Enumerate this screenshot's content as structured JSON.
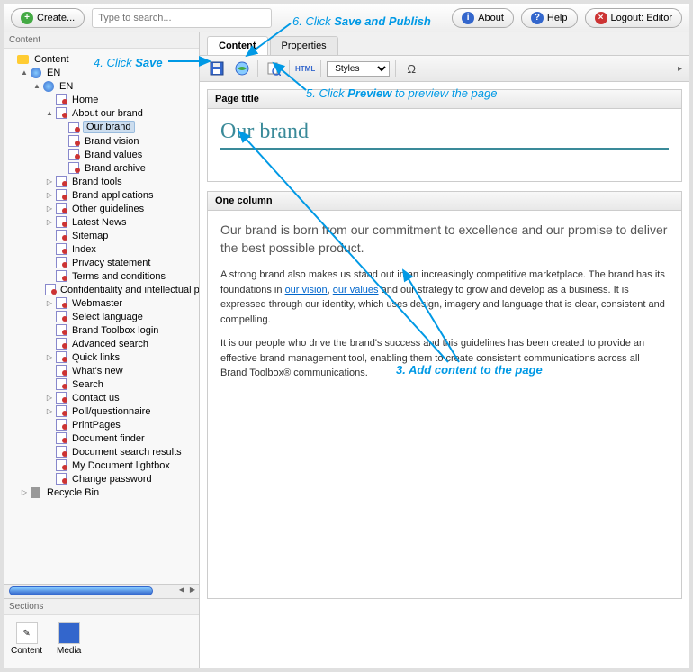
{
  "top": {
    "create": "Create...",
    "search_placeholder": "Type to search...",
    "about": "About",
    "help": "Help",
    "logout": "Logout: Editor"
  },
  "sidebar": {
    "content_hd": "Content",
    "sections_hd": "Sections",
    "sec_content": "Content",
    "sec_media": "Media"
  },
  "tree": [
    {
      "ind": 0,
      "tgl": "",
      "icon": "folder",
      "label": "Content"
    },
    {
      "ind": 1,
      "tgl": "▲",
      "icon": "globe",
      "label": "EN"
    },
    {
      "ind": 2,
      "tgl": "▲",
      "icon": "globe",
      "label": "EN"
    },
    {
      "ind": 3,
      "tgl": "",
      "icon": "page",
      "label": "Home"
    },
    {
      "ind": 3,
      "tgl": "▲",
      "icon": "page",
      "label": "About our brand"
    },
    {
      "ind": 4,
      "tgl": "",
      "icon": "page",
      "label": "Our brand",
      "selected": true
    },
    {
      "ind": 4,
      "tgl": "",
      "icon": "page",
      "label": "Brand vision"
    },
    {
      "ind": 4,
      "tgl": "",
      "icon": "page",
      "label": "Brand values"
    },
    {
      "ind": 4,
      "tgl": "",
      "icon": "page",
      "label": "Brand archive"
    },
    {
      "ind": 3,
      "tgl": "▷",
      "icon": "page",
      "label": "Brand tools"
    },
    {
      "ind": 3,
      "tgl": "▷",
      "icon": "page",
      "label": "Brand applications"
    },
    {
      "ind": 3,
      "tgl": "▷",
      "icon": "page",
      "label": "Other guidelines"
    },
    {
      "ind": 3,
      "tgl": "▷",
      "icon": "page",
      "label": "Latest News"
    },
    {
      "ind": 3,
      "tgl": "",
      "icon": "page",
      "label": "Sitemap"
    },
    {
      "ind": 3,
      "tgl": "",
      "icon": "page",
      "label": "Index"
    },
    {
      "ind": 3,
      "tgl": "",
      "icon": "page",
      "label": "Privacy statement"
    },
    {
      "ind": 3,
      "tgl": "",
      "icon": "page",
      "label": "Terms and conditions"
    },
    {
      "ind": 3,
      "tgl": "",
      "icon": "page",
      "label": "Confidentiality and intellectual p"
    },
    {
      "ind": 3,
      "tgl": "▷",
      "icon": "page",
      "label": "Webmaster"
    },
    {
      "ind": 3,
      "tgl": "",
      "icon": "page",
      "label": "Select language"
    },
    {
      "ind": 3,
      "tgl": "",
      "icon": "page",
      "label": "Brand Toolbox login"
    },
    {
      "ind": 3,
      "tgl": "",
      "icon": "page",
      "label": "Advanced search"
    },
    {
      "ind": 3,
      "tgl": "▷",
      "icon": "page",
      "label": "Quick links"
    },
    {
      "ind": 3,
      "tgl": "",
      "icon": "page",
      "label": "What's new"
    },
    {
      "ind": 3,
      "tgl": "",
      "icon": "page",
      "label": "Search"
    },
    {
      "ind": 3,
      "tgl": "▷",
      "icon": "page",
      "label": "Contact us"
    },
    {
      "ind": 3,
      "tgl": "▷",
      "icon": "page",
      "label": "Poll/questionnaire"
    },
    {
      "ind": 3,
      "tgl": "",
      "icon": "page",
      "label": "PrintPages"
    },
    {
      "ind": 3,
      "tgl": "",
      "icon": "page",
      "label": "Document finder"
    },
    {
      "ind": 3,
      "tgl": "",
      "icon": "page",
      "label": "Document search results"
    },
    {
      "ind": 3,
      "tgl": "",
      "icon": "page",
      "label": "My Document lightbox"
    },
    {
      "ind": 3,
      "tgl": "",
      "icon": "page",
      "label": "Change password"
    },
    {
      "ind": 1,
      "tgl": "▷",
      "icon": "recycle",
      "label": "Recycle Bin"
    }
  ],
  "editor": {
    "tab_content": "Content",
    "tab_properties": "Properties",
    "styles_label": "Styles",
    "html_label": "HTML",
    "omega": "Ω",
    "block1_hd": "Page title",
    "page_title": "Our brand",
    "block2_hd": "One column",
    "intro": "Our brand is born from our commitment to excellence and our promise to deliver the best possible product.",
    "p1_a": "A strong brand also makes us stand out in an increasingly competitive marketplace. The brand has its foundations in ",
    "p1_link1": "our vision",
    "p1_b": ", ",
    "p1_link2": "our values",
    "p1_c": " and our strategy to grow and develop as a business. It is expressed through our identity, which uses design, imagery and language that is clear, consistent and compelling.",
    "p2": "It is our people who drive the brand's success and this guidelines has been created to provide an effective brand management tool, enabling them to create consistent communications across all Brand Toolbox® communications."
  },
  "annotations": {
    "a3": "3. Add content to the page",
    "a4_pre": "4. Click ",
    "a4_b": "Save",
    "a5_pre": "5. Click ",
    "a5_b": "Preview",
    "a5_post": " to preview the page",
    "a6_pre": "6. Click ",
    "a6_b": "Save and Publish"
  }
}
